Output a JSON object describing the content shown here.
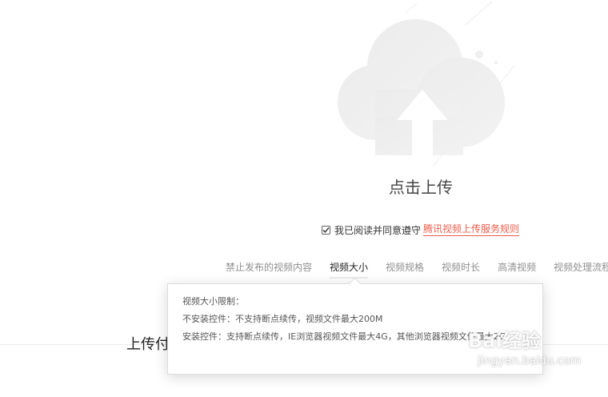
{
  "upload": {
    "title": "点击上传",
    "icon": "upload-cloud-icon"
  },
  "agreement": {
    "checked": true,
    "text": "我已阅读并同意遵守",
    "link": "腾讯视频上传服务规则"
  },
  "tabs": [
    {
      "label": "禁止发布的视频内容"
    },
    {
      "label": "视频大小",
      "active": true
    },
    {
      "label": "视频规格"
    },
    {
      "label": "视频时长"
    },
    {
      "label": "高清视频"
    },
    {
      "label": "视频处理流程"
    }
  ],
  "tooltip": {
    "title": "视频大小限制：",
    "line1": "不安装控件：不支持断点续传，视频文件最大200M",
    "line2": "安装控件：支持断点续传，IE浏览器视频文件最大4G，其他浏览器视频文件最大2G"
  },
  "section": {
    "heading": "上传付"
  },
  "watermark": {
    "brand": "Bai经验",
    "site": "jingyan.baidu.com"
  },
  "colors": {
    "accent_link": "#ee5d4b",
    "cloud_gray": "#e8e8e8",
    "border": "#dcdcdc"
  }
}
